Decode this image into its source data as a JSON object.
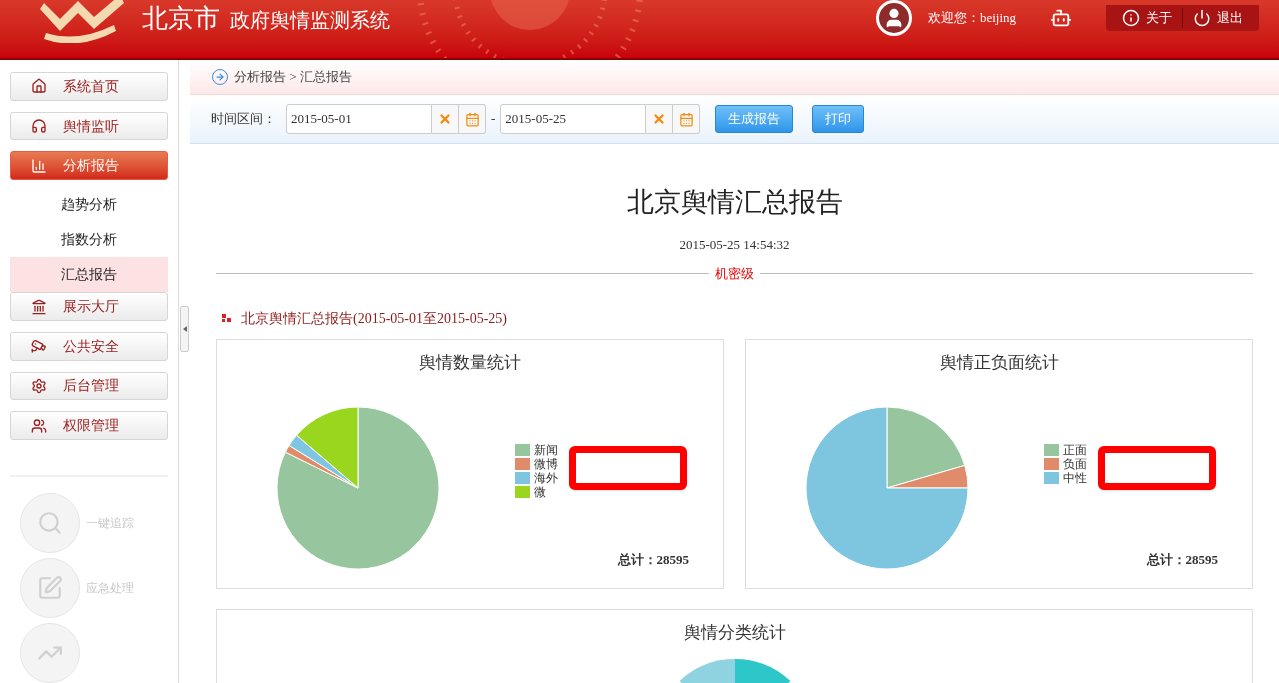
{
  "header": {
    "city": "北京市",
    "system": "政府舆情监测系统",
    "welcome": "欢迎您：",
    "user": "beijing",
    "links": [
      {
        "kind": "about",
        "label": "关于"
      },
      {
        "kind": "logout",
        "label": "退出"
      }
    ]
  },
  "sidebar": {
    "items": [
      {
        "label": "系统首页",
        "selected": false
      },
      {
        "label": "舆情监听",
        "selected": false
      },
      {
        "label": "分析报告",
        "selected": true,
        "expanded": true,
        "children": [
          {
            "label": "趋势分析",
            "selected": false
          },
          {
            "label": "指数分析",
            "selected": false
          },
          {
            "label": "汇总报告",
            "selected": true
          }
        ]
      },
      {
        "label": "展示大厅",
        "selected": false
      },
      {
        "label": "公共安全",
        "selected": false
      },
      {
        "label": "后台管理",
        "selected": false
      },
      {
        "label": "权限管理",
        "selected": false
      }
    ],
    "quick": [
      {
        "label": "一键追踪"
      },
      {
        "label": "应急处理"
      }
    ]
  },
  "breadcrumb": "分析报告 > 汇总报告",
  "toolbar": {
    "label": "时间区间：",
    "from": "2015-05-01",
    "separator": "-",
    "to": "2015-05-25",
    "buttons": [
      "生成报告",
      "打印"
    ]
  },
  "report": {
    "title": "北京舆情汇总报告",
    "datetime": "2015-05-25 14:54:32",
    "classification": "机密级",
    "section": "北京舆情汇总报告(2015-05-01至2015-05-25)",
    "cards": [
      {
        "title": "舆情数量统计",
        "legend": [
          {
            "label": "新闻",
            "color": "#96c59e"
          },
          {
            "label": "微博",
            "color": "#e08c6b"
          },
          {
            "label": "海外",
            "color": "#7ec6e0"
          },
          {
            "label": "微",
            "color": "#9bd61f"
          }
        ],
        "total": "总计：28595"
      },
      {
        "title": "舆情正负面统计",
        "legend": [
          {
            "label": "正面",
            "color": "#96c59e"
          },
          {
            "label": "负面",
            "color": "#e08c6b"
          },
          {
            "label": "中性",
            "color": "#7ec6e0"
          }
        ],
        "total": "总计：28595"
      }
    ],
    "bottom_card": {
      "title": "舆情分类统计"
    }
  }
}
